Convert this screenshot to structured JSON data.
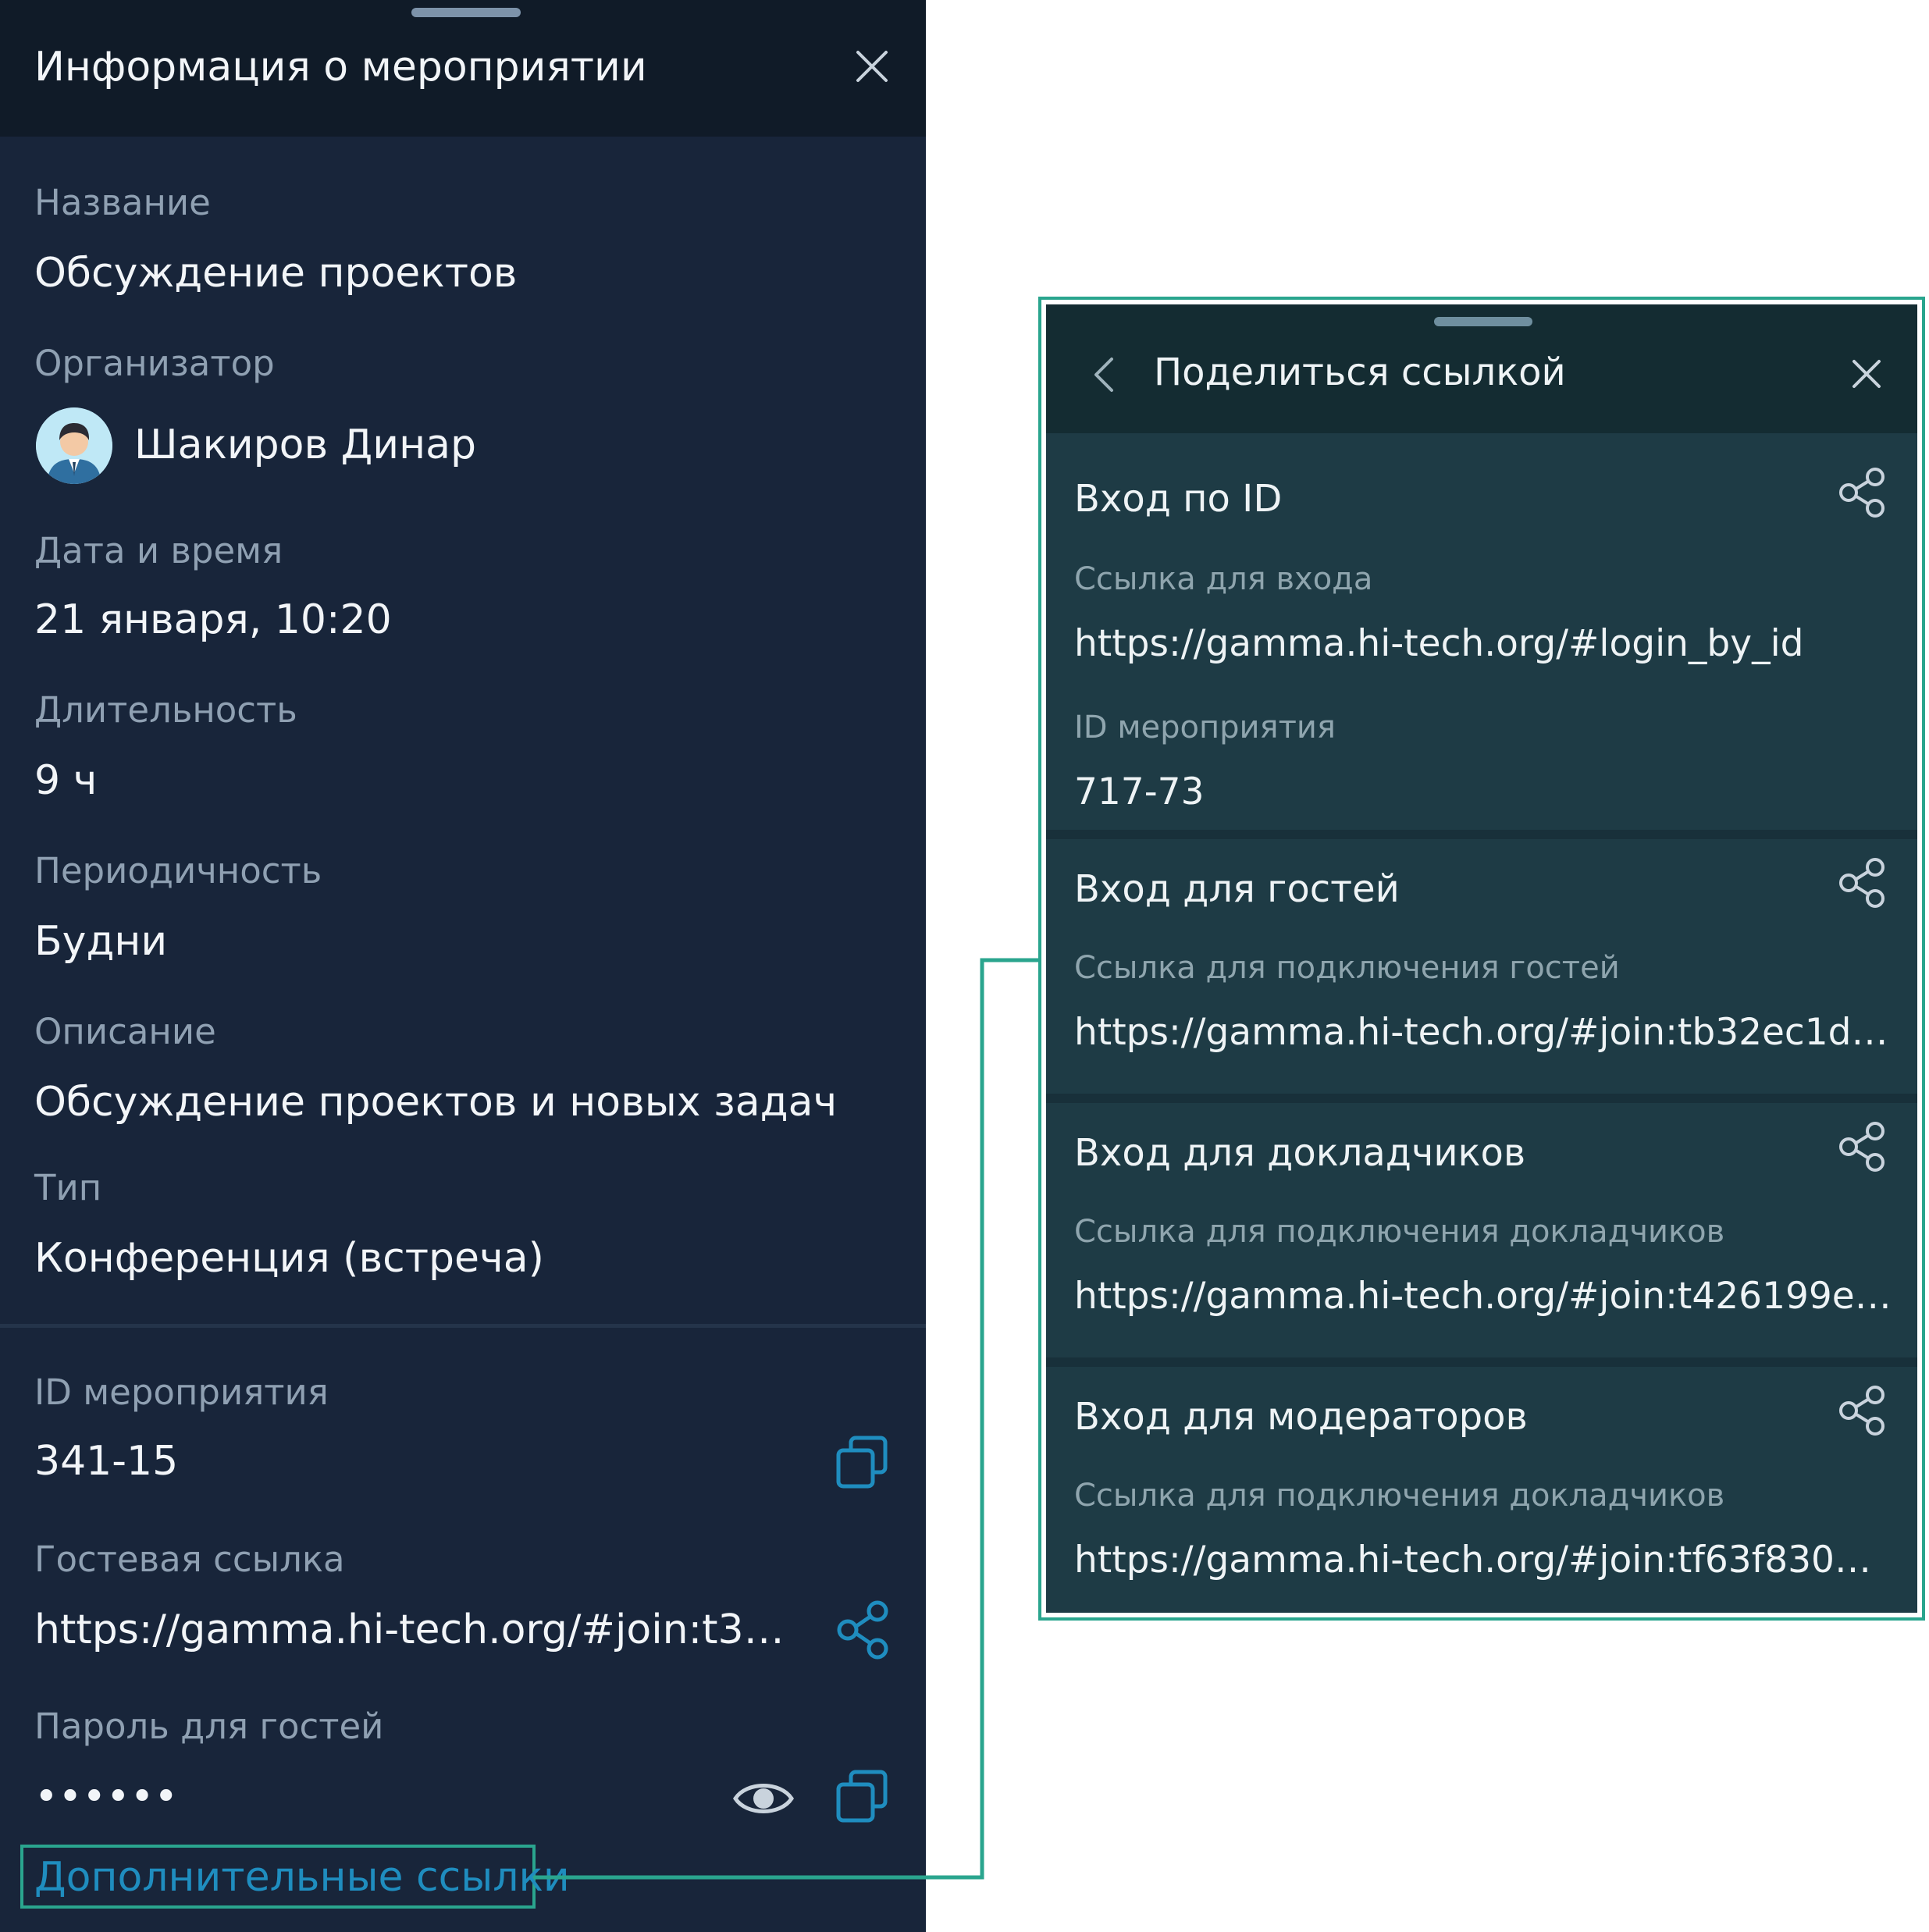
{
  "left_panel": {
    "title": "Информация о мероприятии",
    "fields": {
      "name_label": "Название",
      "name_value": "Обсуждение проектов",
      "organizer_label": "Организатор",
      "organizer_value": "Шакиров Динар",
      "datetime_label": "Дата и время",
      "datetime_value": "21 января, 10:20",
      "duration_label": "Длительность",
      "duration_value": "9 ч",
      "periodicity_label": "Периодичность",
      "periodicity_value": "Будни",
      "description_label": "Описание",
      "description_value": "Обсуждение проектов и новых задач",
      "type_label": "Тип",
      "type_value": "Конференция (встреча)",
      "event_id_label": "ID мероприятия",
      "event_id_value": "341-15",
      "guest_link_label": "Гостевая ссылка",
      "guest_link_value": "https://gamma.hi-tech.org/#join:t35f24...",
      "guest_password_label": "Пароль для гостей",
      "guest_password_value": "••••••"
    },
    "extra_links_label": "Дополнительные ссылки"
  },
  "right_panel": {
    "title": "Поделиться ссылкой",
    "cards": [
      {
        "title": "Вход по ID",
        "link_label": "Ссылка для входа",
        "link_value": "https://gamma.hi-tech.org/#login_by_id",
        "id_label": "ID мероприятия",
        "id_value": "717-73"
      },
      {
        "title": "Вход для гостей",
        "link_label": "Ссылка для подключения гостей",
        "link_value": "https://gamma.hi-tech.org/#join:tb32ec1d7-3c0..."
      },
      {
        "title": "Вход для докладчиков",
        "link_label": "Ссылка для подключения докладчиков",
        "link_value": "https://gamma.hi-tech.org/#join:t426199e2-638..."
      },
      {
        "title": "Вход для модераторов",
        "link_label": "Ссылка для подключения докладчиков",
        "link_value": "https://gamma.hi-tech.org/#join:tf63f8303-3a7..."
      }
    ]
  },
  "icons": {
    "close": "close-icon",
    "back": "chevron-left-icon",
    "share": "share-icon",
    "copy": "copy-icon",
    "eye": "eye-icon",
    "avatar": "user-avatar"
  },
  "colors": {
    "left_bg": "#18253a",
    "left_header_bg": "#101b28",
    "right_bg": "#1e3b45",
    "right_header_bg": "#142c32",
    "accent_blue": "#1f8dbf",
    "highlight_green": "#2aa58e"
  }
}
